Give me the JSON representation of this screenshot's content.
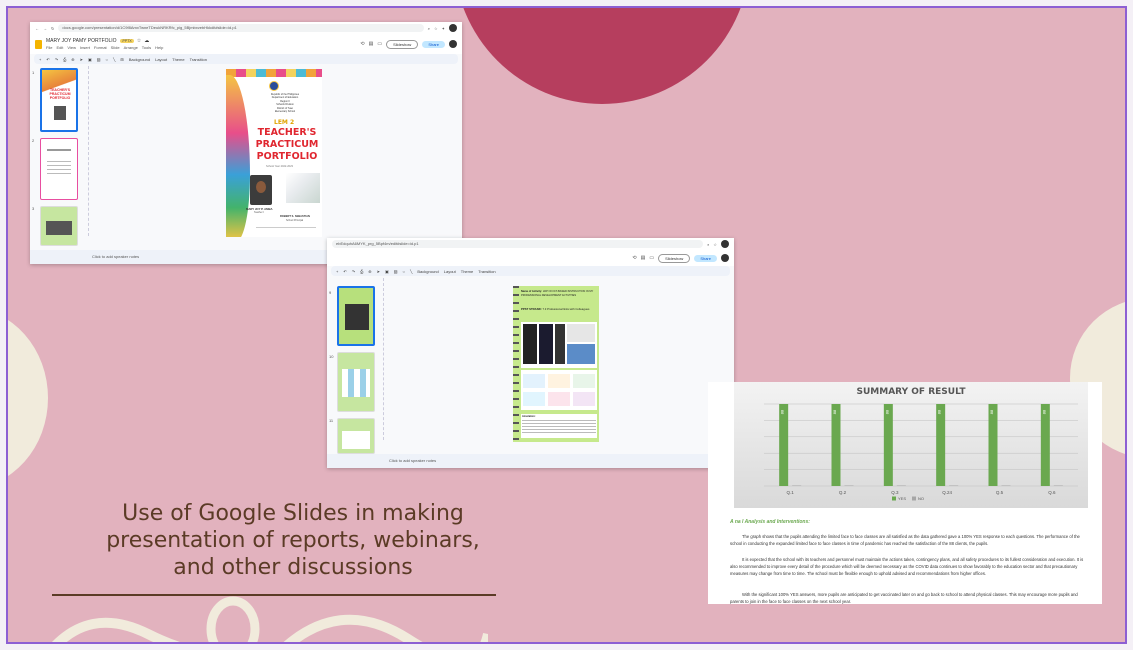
{
  "caption": {
    "line1": "Use of Google Slides in making",
    "line2": "presentation of reports, webinars,",
    "line3": "and other discussions"
  },
  "window1": {
    "url": "docs.google.com/presentation/d/1C9f8AmxTwneTDeukNRKRfc_pig_5BjmbxvebHkkdit#slide=id.p1",
    "doc_title": "MARY JOY PAMY PORTFOLIO",
    "badge": ".PPTX",
    "menus": [
      "File",
      "Edit",
      "View",
      "Insert",
      "Format",
      "Slide",
      "Arrange",
      "Tools",
      "Help"
    ],
    "slideshow": "Slideshow",
    "share": "Share",
    "toolbar_items": [
      "Background",
      "Layout",
      "Theme",
      "Transition"
    ],
    "notes": "Click to add speaker notes",
    "thumb_numbers": [
      "1",
      "2",
      "3"
    ]
  },
  "portfolio": {
    "header_lines": [
      "Republic of the Philippines",
      "Department of Education",
      "Region II",
      "Schools Division",
      "District of Tuao",
      "Elementary School"
    ],
    "lem": "LEM 2",
    "title1": "TEACHER'S",
    "title2": "PRACTICUM",
    "title3": "PORTFOLIO",
    "school_year": "School Year 2022-2023",
    "name": "MARY JOY P. AMBA",
    "role": "Teacher I",
    "mentor": "ROBERT S. SEBASTIAN",
    "mentor_role": "School Principal"
  },
  "window2": {
    "url": "ebEdquhA6MYK_prg_5Bpf4m/edit#slide=id.p1",
    "slideshow": "Slideshow",
    "share": "Share",
    "toolbar_items": [
      "Background",
      "Layout",
      "Theme",
      "Transition"
    ],
    "notes": "Click to add speaker notes",
    "thumb_numbers": [
      "9",
      "10",
      "11"
    ]
  },
  "activity": {
    "name_label": "Name of Activity:",
    "name_value": "LDP ON ICT-BASED INSTRUCTION IN MY PROFESSIONAL DEVELOPMENT ACTIVITIES",
    "ppst_label": "PPST STRAND:",
    "ppst_value": "7.3 Professional links with Colleagues",
    "annotation_label": "Annotation:"
  },
  "report": {
    "analysis_heading": "A na l Analysis and Interventions:",
    "para1": "The graph shows that the pupils attending the limited face to face classes are all satisfied as the data gathered gave a 100% YES response to each questions. The performance of the school in conducting the expanded limited face to face classes in time of pandemic has reached the satisfaction of the 88 clients, the pupils.",
    "para2": "It is expected that the school with its teachers and personnel must maintain the actions taken, contingency plans, and all safety procedures to its fullest consideration and execution. It is also recommended to improve every detail of the procedure which will be deemed necessary as the COVID data continues to show favorably to the education sector and that precautionary measures may change from time to time. The school must be flexible enough to uphold advised and recommendations from higher offices.",
    "para3": "With the significant 100% YES answers, more pupils are anticipated to get vaccinated later on and go back to school to attend physical classes. This may encourage more pupils and parents to join in the face to face classes on the next school year."
  },
  "chart_data": {
    "type": "bar",
    "title": "SUMMARY OF RESULT",
    "categories": [
      "Q.1",
      "Q.2",
      "Q.3",
      "Q.24",
      "Q.5",
      "Q.6"
    ],
    "series": [
      {
        "name": "YES",
        "values": [
          100,
          100,
          100,
          100,
          100,
          100
        ],
        "color": "#6aa84f"
      },
      {
        "name": "NO",
        "values": [
          0,
          0,
          0,
          0,
          0,
          0
        ],
        "color": "#a6a6a6"
      }
    ],
    "data_labels": [
      "88",
      "88",
      "88",
      "88",
      "88",
      "88"
    ],
    "ylim": [
      0,
      100
    ],
    "grid": true,
    "legend": "bottom"
  },
  "colors": {
    "background": "#e2b2be",
    "frame": "#8d5fd3",
    "accent_circle": "#b63e5e",
    "cream": "#f1ebdc",
    "caption_text": "#5b3b26",
    "chart_green": "#6aa84f",
    "share_blue": "#c2e7ff"
  }
}
